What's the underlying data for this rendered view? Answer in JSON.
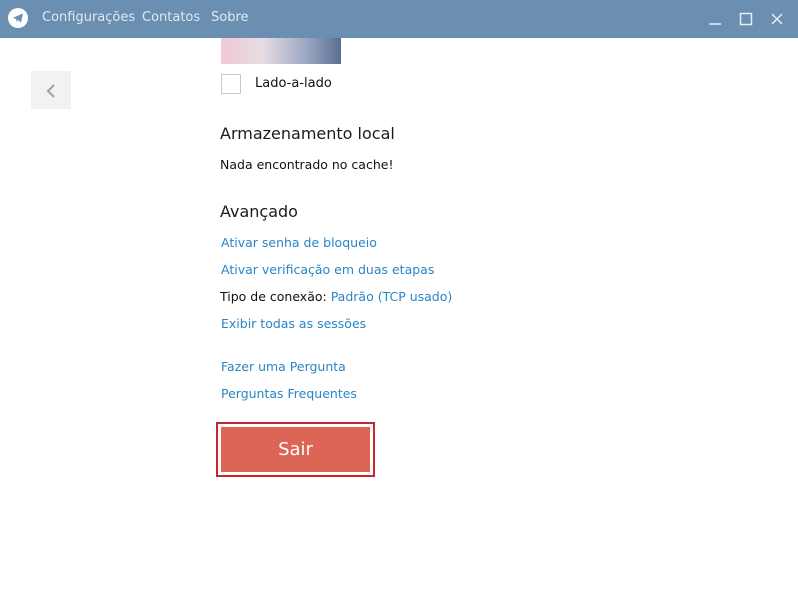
{
  "titlebar": {
    "menu": [
      "Configurações",
      "Contatos",
      "Sobre"
    ],
    "window_controls": [
      "minimize-icon",
      "maximize-icon",
      "close-icon"
    ]
  },
  "navigation": {
    "back_icon": "chevron-left-icon"
  },
  "chat_background": {
    "side_by_side_label": "Lado-a-lado",
    "side_by_side_checked": false
  },
  "local_storage": {
    "title": "Armazenamento local",
    "status": "Nada encontrado no cache!"
  },
  "advanced": {
    "title": "Avançado",
    "lock_password_link": "Ativar senha de bloqueio",
    "two_step_link": "Ativar verificação em duas etapas",
    "connection_label": "Tipo de conexão:",
    "connection_value": "Padrão (TCP usado)",
    "sessions_link": "Exibir todas as sessões"
  },
  "help": {
    "ask_question_link": "Fazer uma Pergunta",
    "faq_link": "Perguntas Frequentes"
  },
  "logout": {
    "label": "Sair"
  },
  "colors": {
    "titlebar": "#6b8fb1",
    "link": "#2a85c6",
    "logout_button": "#dc6555",
    "highlight_border": "#c9252f"
  }
}
